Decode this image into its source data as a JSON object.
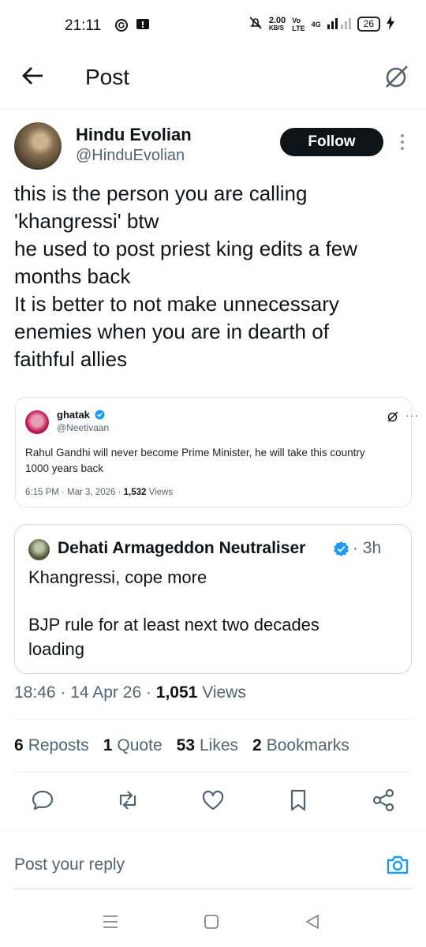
{
  "status_bar": {
    "time": "21:11",
    "net_speed_top": "2.00",
    "net_speed_bottom": "KB/S",
    "volte_top": "Vo",
    "volte_bottom": "LTE",
    "network": "4G",
    "battery": "26"
  },
  "header": {
    "title": "Post"
  },
  "post": {
    "author_name": "Hindu Evolian",
    "author_handle": "@HinduEvolian",
    "follow_label": "Follow",
    "text_lines": [
      "this is the person you are calling",
      "'khangressi' btw",
      "he used to post priest king edits a few",
      "months back",
      "It is better to not make unnecessary",
      "enemies when you are in dearth of",
      "faithful allies"
    ],
    "timestamp": "18:46 · 14 Apr 26 · ",
    "views_count": "1,051",
    "views_label": " Views"
  },
  "embedded_card": {
    "name": "ghatak",
    "handle": "@Neetivaan",
    "text_lines": [
      "Rahul Gandhi will never become Prime Minister, he will take this country",
      "1000 years back"
    ],
    "meta": "6:15 PM · Mar 3, 2026 · ",
    "views_count": "1,532",
    "views_label": " Views",
    "dots": "···"
  },
  "quote_tweet": {
    "name": "Dehati Armageddon Neutraliser",
    "time": "· 3h",
    "lines": [
      "Khangressi, cope more",
      "BJP rule for at least next two decades",
      "loading"
    ]
  },
  "stats": [
    {
      "count": "6",
      "label": "Reposts"
    },
    {
      "count": "1",
      "label": "Quote"
    },
    {
      "count": "53",
      "label": "Likes"
    },
    {
      "count": "2",
      "label": "Bookmarks"
    }
  ],
  "reply": {
    "placeholder": "Post your reply"
  },
  "colors": {
    "accent": "#1d9bf0",
    "text": "#0f1419",
    "secondary": "#536471"
  }
}
